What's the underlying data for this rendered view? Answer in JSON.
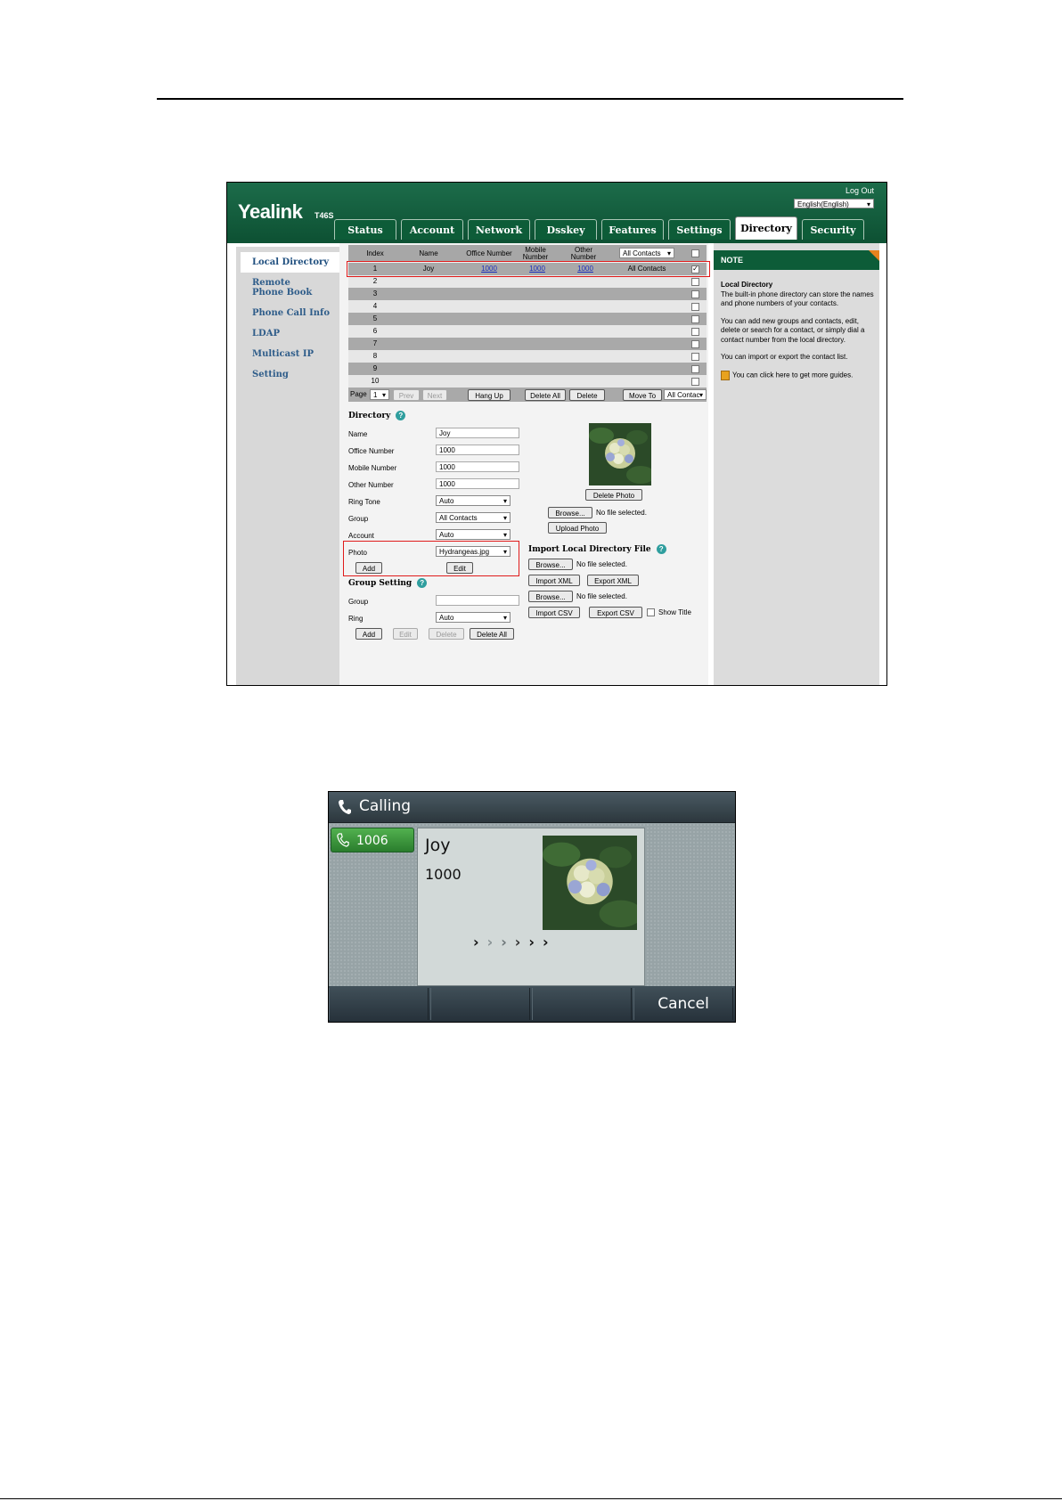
{
  "web": {
    "logo": "Yealink",
    "model": "T46S",
    "logout": "Log Out",
    "language": "English(English)",
    "tabs": [
      "Status",
      "Account",
      "Network",
      "Dsskey",
      "Features",
      "Settings",
      "Directory",
      "Security"
    ],
    "active_tab": "Directory",
    "sidebar": [
      "Local Directory",
      "Remote Phone Book",
      "Phone Call Info",
      "LDAP",
      "Multicast IP",
      "Setting"
    ],
    "table": {
      "headers": [
        "Index",
        "Name",
        "Office Number",
        "Mobile Number",
        "Other Number"
      ],
      "filter": "All Contacts",
      "rows": [
        {
          "index": "1",
          "name": "Joy",
          "office": "1000",
          "mobile": "1000",
          "other": "1000",
          "group": "All Contacts",
          "checked": true
        },
        {
          "index": "2"
        },
        {
          "index": "3"
        },
        {
          "index": "4"
        },
        {
          "index": "5"
        },
        {
          "index": "6"
        },
        {
          "index": "7"
        },
        {
          "index": "8"
        },
        {
          "index": "9"
        },
        {
          "index": "10"
        }
      ]
    },
    "pager": {
      "page_label": "Page",
      "page": "1",
      "prev": "Prev",
      "next": "Next",
      "hang_up": "Hang Up",
      "delete_all": "Delete All",
      "delete": "Delete",
      "move_to": "Move To",
      "move_target": "All Contac"
    },
    "directory": {
      "title": "Directory",
      "name_label": "Name",
      "name": "Joy",
      "office_label": "Office Number",
      "office": "1000",
      "mobile_label": "Mobile Number",
      "mobile": "1000",
      "other_label": "Other Number",
      "other": "1000",
      "ringtone_label": "Ring Tone",
      "ringtone": "Auto",
      "group_label": "Group",
      "group": "All Contacts",
      "account_label": "Account",
      "account": "Auto",
      "photo_label": "Photo",
      "photo": "Hydrangeas.jpg",
      "add": "Add",
      "edit": "Edit"
    },
    "photo_panel": {
      "delete_photo": "Delete Photo",
      "browse": "Browse...",
      "no_file": "No file selected.",
      "upload_photo": "Upload Photo"
    },
    "import": {
      "title": "Import Local Directory File",
      "browse": "Browse...",
      "no_file": "No file selected.",
      "import_xml": "Import XML",
      "export_xml": "Export XML",
      "import_csv": "Import CSV",
      "export_csv": "Export CSV",
      "show_title": "Show Title"
    },
    "group_setting": {
      "title": "Group Setting",
      "group_label": "Group",
      "ring_label": "Ring",
      "ring": "Auto",
      "add": "Add",
      "edit": "Edit",
      "delete": "Delete",
      "delete_all": "Delete All"
    },
    "note": {
      "header": "NOTE",
      "subtitle": "Local Directory",
      "p1": "The built-in phone directory can store the names and phone numbers of your contacts.",
      "p2": "You can add new groups and contacts, edit, delete or search for a contact, or simply dial a contact number from the local directory.",
      "p3": "You can import or export the contact list.",
      "p4": "You can click here to get more guides."
    }
  },
  "phone": {
    "title": "Calling",
    "line": "1006",
    "contact_name": "Joy",
    "contact_number": "1000",
    "softkeys": [
      "",
      "",
      "",
      "Cancel"
    ]
  }
}
